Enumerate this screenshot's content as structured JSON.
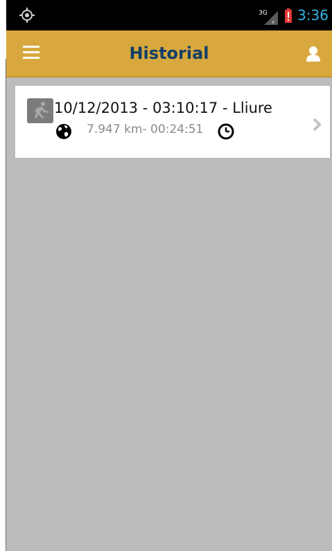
{
  "status_bar": {
    "time": "3:36",
    "network": "3G"
  },
  "app_bar": {
    "title": "Historial"
  },
  "history": [
    {
      "title": "10/12/2013 - 03:10:17 - Lliure",
      "summary": "7.947 km- 00:24:51"
    }
  ],
  "colors": {
    "app_bar": "#d8a83e",
    "title_text": "#123e66",
    "status_time": "#33b5e5",
    "battery_alert": "#e53935",
    "background": "#bcbcbc"
  },
  "icons": [
    "gps-icon",
    "signal-3g-icon",
    "battery-alert-icon",
    "menu-icon",
    "user-icon",
    "runner-thumbnail-icon",
    "globe-icon",
    "clock-icon",
    "chevron-right-icon"
  ]
}
